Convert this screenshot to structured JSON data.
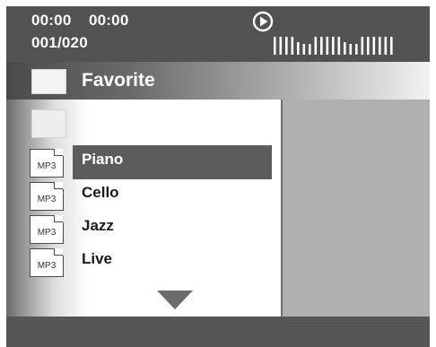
{
  "status": {
    "time_elapsed": "00:00",
    "time_total": "00:00",
    "track_counter": "001/020",
    "play_icon": "play-circle-icon",
    "level_meter_icon": "level-meter-icon"
  },
  "folder": {
    "title": "Favorite",
    "icon": "folder-icon"
  },
  "file_list": {
    "parent_folder_icon": "folder-icon",
    "file_type_label": "MP3",
    "items": [
      {
        "name": "Piano",
        "selected": true
      },
      {
        "name": "Cello",
        "selected": false
      },
      {
        "name": "Jazz",
        "selected": false
      },
      {
        "name": "Live",
        "selected": false
      }
    ],
    "scroll_icon": "triangle-down-icon"
  },
  "colors": {
    "status_bar": "#525252",
    "selection": "#5c5c5c",
    "preview_panel": "#b0b0b0",
    "bottom_bar": "#565656"
  }
}
